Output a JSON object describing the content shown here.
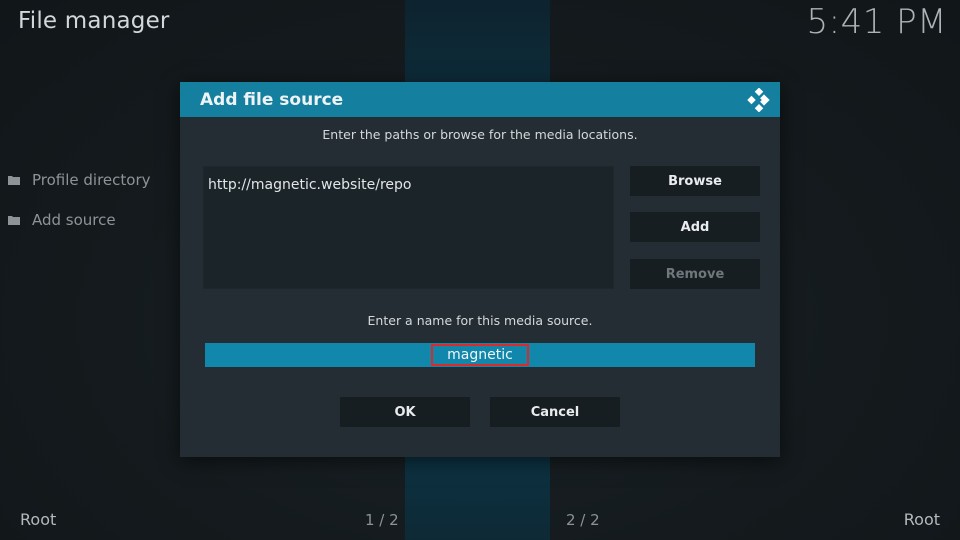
{
  "header": {
    "title": "File manager",
    "clock": "5:41 PM"
  },
  "sidebar": {
    "items": [
      {
        "label": "Profile directory",
        "icon": "folder-icon"
      },
      {
        "label": "Add source",
        "icon": "folder-icon"
      }
    ]
  },
  "footer": {
    "left": "Root",
    "center_left": "1 / 2",
    "center_right": "2 / 2",
    "right": "Root"
  },
  "dialog": {
    "title": "Add file source",
    "icon": "kodi-logo-icon",
    "paths_instruction": "Enter the paths or browse for the media locations.",
    "paths": [
      "http://magnetic.website/repo"
    ],
    "buttons": {
      "browse": "Browse",
      "add": "Add",
      "remove": "Remove"
    },
    "name_instruction": "Enter a name for this media source.",
    "name_value": "magnetic",
    "ok": "OK",
    "cancel": "Cancel"
  },
  "colors": {
    "accent": "#157fa0",
    "field": "#1187ac",
    "highlight": "#d92b2b",
    "dialog_bg": "#232d33"
  }
}
